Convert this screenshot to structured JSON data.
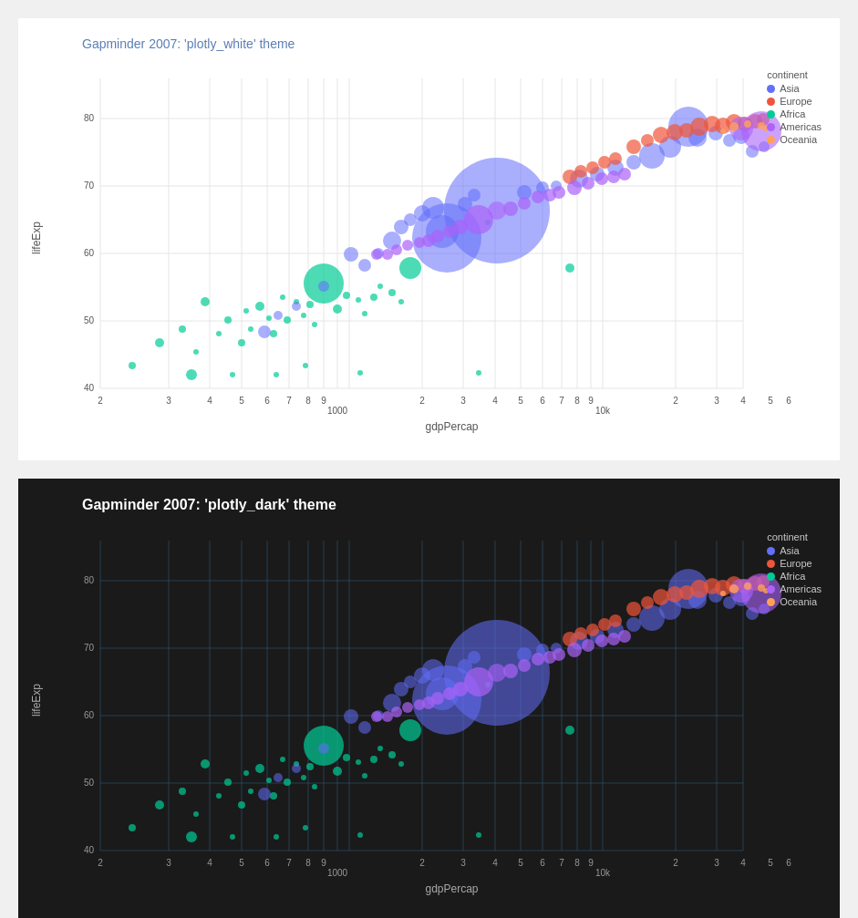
{
  "chart1": {
    "title": "Gapminder 2007: 'plotly_white' theme",
    "theme": "white",
    "xLabel": "gdpPercap",
    "yLabel": "lifeExp",
    "legend": {
      "title": "continent",
      "items": [
        {
          "label": "Asia",
          "color": "#636EFA"
        },
        {
          "label": "Europe",
          "color": "#EF553B"
        },
        {
          "label": "Africa",
          "color": "#00CC96"
        },
        {
          "label": "Americas",
          "color": "#AB63FA"
        },
        {
          "label": "Oceania",
          "color": "#FFA15A"
        }
      ]
    }
  },
  "chart2": {
    "title": "Gapminder 2007: 'plotly_dark' theme",
    "theme": "dark",
    "xLabel": "gdpPercap",
    "yLabel": "lifeExp",
    "legend": {
      "title": "continent",
      "items": [
        {
          "label": "Asia",
          "color": "#636EFA"
        },
        {
          "label": "Europe",
          "color": "#EF553B"
        },
        {
          "label": "Africa",
          "color": "#00CC96"
        },
        {
          "label": "Americas",
          "color": "#AB63FA"
        },
        {
          "label": "Oceania",
          "color": "#FFA15A"
        }
      ]
    }
  }
}
